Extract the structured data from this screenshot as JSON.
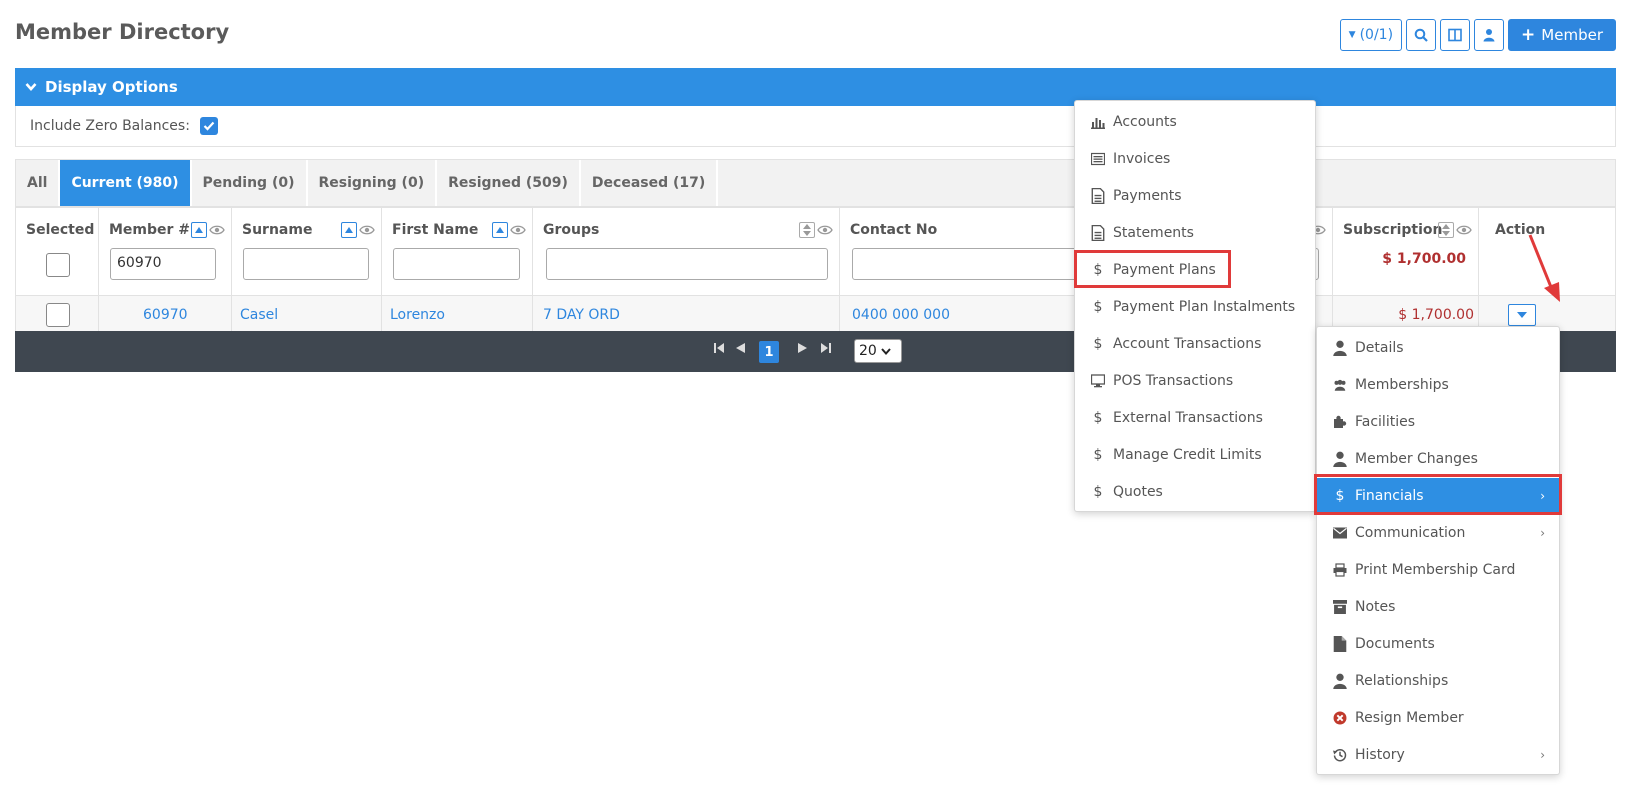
{
  "page_title": "Member Directory",
  "toolbar": {
    "filter_count": "(0/1)",
    "add_member_label": "Member"
  },
  "display_options": {
    "title": "Display Options",
    "include_zero_label": "Include Zero Balances:",
    "include_zero_checked": true
  },
  "tabs": [
    {
      "label": "All",
      "active": false
    },
    {
      "label": "Current (980)",
      "active": true
    },
    {
      "label": "Pending (0)",
      "active": false
    },
    {
      "label": "Resigning (0)",
      "active": false
    },
    {
      "label": "Resigned (509)",
      "active": false
    },
    {
      "label": "Deceased (17)",
      "active": false
    }
  ],
  "columns": {
    "selected": "Selected",
    "member_no": "Member #",
    "surname": "Surname",
    "first_name": "First Name",
    "groups": "Groups",
    "contact_no": "Contact No",
    "subscription": "Subscription",
    "action": "Action"
  },
  "filters": {
    "member_no": "60970",
    "subscription_total": "$ 1,700.00"
  },
  "row": {
    "member_no": "60970",
    "surname": "Casel",
    "first_name": "Lorenzo",
    "groups": "7 DAY ORD",
    "contact_no": "0400 000 000",
    "subscription": "$ 1,700.00"
  },
  "pager": {
    "current_page": "1",
    "page_size": "20"
  },
  "financials_submenu": [
    {
      "icon": "bar-chart-icon",
      "label": "Accounts"
    },
    {
      "icon": "list-icon",
      "label": "Invoices"
    },
    {
      "icon": "document-icon",
      "label": "Payments"
    },
    {
      "icon": "document-icon",
      "label": "Statements"
    },
    {
      "icon": "dollar-icon",
      "label": "Payment Plans"
    },
    {
      "icon": "dollar-icon",
      "label": "Payment Plan Instalments"
    },
    {
      "icon": "dollar-icon",
      "label": "Account Transactions"
    },
    {
      "icon": "monitor-icon",
      "label": "POS Transactions"
    },
    {
      "icon": "dollar-icon",
      "label": "External Transactions"
    },
    {
      "icon": "dollar-icon",
      "label": "Manage Credit Limits"
    },
    {
      "icon": "dollar-icon",
      "label": "Quotes"
    }
  ],
  "action_menu": [
    {
      "icon": "user-icon",
      "label": "Details",
      "submenu": false
    },
    {
      "icon": "users-icon",
      "label": "Memberships",
      "submenu": false
    },
    {
      "icon": "puzzle-icon",
      "label": "Facilities",
      "submenu": false
    },
    {
      "icon": "user-icon",
      "label": "Member Changes",
      "submenu": false
    },
    {
      "icon": "dollar-icon",
      "label": "Financials",
      "submenu": true
    },
    {
      "icon": "envelope-icon",
      "label": "Communication",
      "submenu": true
    },
    {
      "icon": "printer-icon",
      "label": "Print Membership Card",
      "submenu": false
    },
    {
      "icon": "archive-icon",
      "label": "Notes",
      "submenu": false
    },
    {
      "icon": "file-icon",
      "label": "Documents",
      "submenu": false
    },
    {
      "icon": "user-icon",
      "label": "Relationships",
      "submenu": false
    },
    {
      "icon": "x-circle-icon",
      "label": "Resign Member",
      "submenu": false
    },
    {
      "icon": "history-icon",
      "label": "History",
      "submenu": true
    }
  ],
  "colors": {
    "accent": "#2e8fe3",
    "money": "#b03030",
    "highlight_box": "#e03a3a",
    "pager_bg": "#3f4750"
  }
}
